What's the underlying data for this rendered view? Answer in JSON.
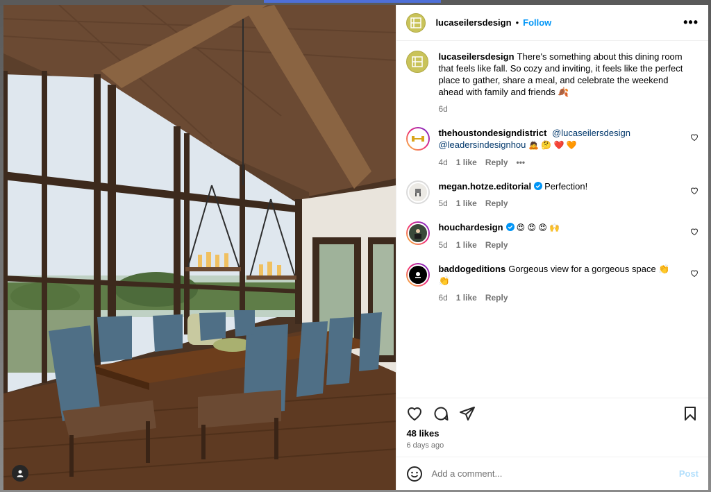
{
  "post": {
    "username": "lucaseilersdesign",
    "separator": "•",
    "follow_label": "Follow",
    "more_label": "•••",
    "caption": {
      "username": "lucaseilersdesign",
      "text": "There's something about this dining room that feels like fall. So cozy and inviting, it feels like the perfect place to gather, share a meal, and celebrate the weekend ahead with family and friends 🍂",
      "age": "6d"
    },
    "comments": [
      {
        "username": "thehoustondesigndistrict",
        "mention1": "@lucaseilersdesign",
        "mention2": "@leadersindesignhou",
        "emojis": "🙇 🤔 ❤️ 🧡",
        "age": "4d",
        "likes": "1 like",
        "reply": "Reply",
        "more": "•••"
      },
      {
        "username": "megan.hotze.editorial",
        "text": "Perfection!",
        "age": "5d",
        "likes": "1 like",
        "reply": "Reply"
      },
      {
        "username": "houchardesign",
        "text": "😍 😍 😍 🙌",
        "age": "5d",
        "likes": "1 like",
        "reply": "Reply"
      },
      {
        "username": "baddogeditions",
        "text": "Gorgeous view for a gorgeous space 👏 👏",
        "age": "6d",
        "likes": "1 like",
        "reply": "Reply"
      }
    ],
    "likes_count": "48 likes",
    "date": "6 days ago",
    "add_comment_placeholder": "Add a comment...",
    "post_label": "Post"
  },
  "colors": {
    "accent": "#0095f6",
    "muted": "#737373",
    "logo": "#c9c35a"
  },
  "icons": [
    "heart-icon",
    "comment-icon",
    "share-icon",
    "bookmark-icon",
    "emoji-icon",
    "user-tag-icon",
    "more-icon",
    "verified-icon"
  ]
}
